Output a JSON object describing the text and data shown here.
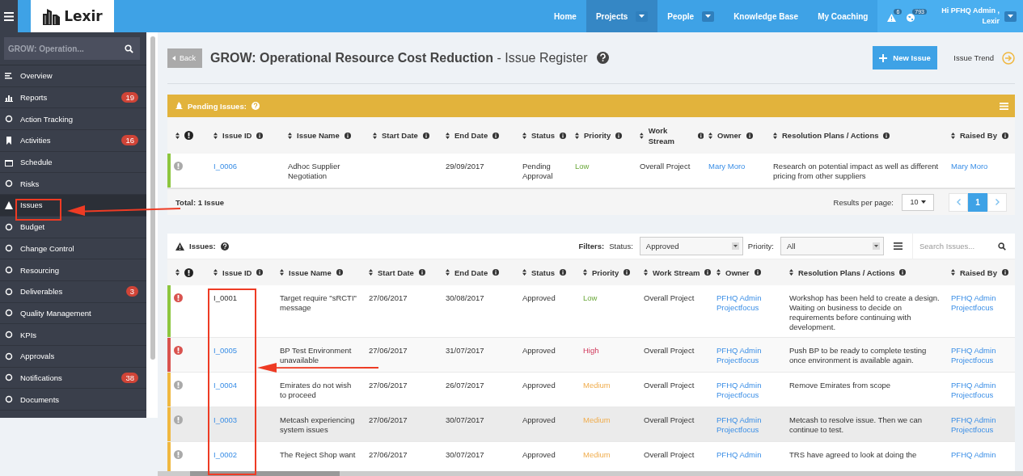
{
  "logo": "Lexir",
  "nav": [
    {
      "label": "Home",
      "selected": false,
      "dropdown": false
    },
    {
      "label": "Projects",
      "selected": true,
      "dropdown": true
    },
    {
      "label": "People",
      "selected": false,
      "dropdown": true
    },
    {
      "label": "Knowledge Base",
      "selected": false,
      "dropdown": false
    },
    {
      "label": "My Coaching",
      "selected": false,
      "dropdown": false
    }
  ],
  "alerts_badge": "6",
  "globe_badge": "793",
  "user": "Hi PFHQ Admin , Lexir",
  "sidebar": {
    "search_value": "GROW: Operation...",
    "items": [
      {
        "label": "Overview",
        "selected": false
      },
      {
        "label": "Reports",
        "selected": false,
        "badge": "19"
      },
      {
        "label": "Action Tracking",
        "selected": false
      },
      {
        "label": "Activities",
        "selected": false,
        "badge": "16"
      },
      {
        "label": "Schedule",
        "selected": false
      },
      {
        "label": "Risks",
        "selected": false
      },
      {
        "label": "Issues",
        "selected": true
      },
      {
        "label": "Budget",
        "selected": false
      },
      {
        "label": "Change Control",
        "selected": false
      },
      {
        "label": "Resourcing",
        "selected": false
      },
      {
        "label": "Deliverables",
        "selected": false,
        "badge": "3"
      },
      {
        "label": "Quality Management",
        "selected": false
      },
      {
        "label": "KPIs",
        "selected": false
      },
      {
        "label": "Approvals",
        "selected": false
      },
      {
        "label": "Notifications",
        "selected": false,
        "badge": "38"
      },
      {
        "label": "Documents",
        "selected": false
      }
    ]
  },
  "back_button": "Back",
  "title_bold": "GROW: Operational Resource Cost Reduction",
  "title_rest": "- Issue Register",
  "new_issue_button": "New Issue",
  "issue_trend": "Issue Trend",
  "pending": {
    "title": "Pending Issues:",
    "columns": [
      "Issue ID",
      "Issue Name",
      "Start Date",
      "End Date",
      "Status",
      "Priority",
      "Work Stream",
      "Owner",
      "Resolution Plans / Actions",
      "Raised By"
    ],
    "rows": [
      {
        "color": "#8cc63f",
        "alert": false,
        "id": "I_0006",
        "id_link": true,
        "name": "Adhoc Supplier Negotiation",
        "start": "",
        "end": "29/09/2017",
        "status": "Pending Approval",
        "priority": {
          "label": "Low",
          "kind": "low"
        },
        "stream": "Overall Project",
        "owner": "Mary Moro",
        "resolution": "Research on potential impact as well as different pricing from other suppliers",
        "raised_by": "Mary Moro",
        "selected": false
      }
    ],
    "total": "Total: 1 Issue",
    "results_label": "Results per page:",
    "results_value": "10",
    "page": "1"
  },
  "issues": {
    "title": "Issues:",
    "filters_label": "Filters:",
    "status_label": "Status:",
    "status_value": "Approved",
    "priority_label": "Priority:",
    "priority_value": "All",
    "search_placeholder": "Search Issues...",
    "columns": [
      "Issue ID",
      "Issue Name",
      "Start Date",
      "End Date",
      "Status",
      "Priority",
      "Work Stream",
      "Owner",
      "Resolution Plans / Actions",
      "Raised By"
    ],
    "rows": [
      {
        "color": "#8cc63f",
        "alert": true,
        "id": "I_0001",
        "id_link": false,
        "name": "Target require \"sRCTI\" message",
        "start": "27/06/2017",
        "end": "30/08/2017",
        "status": "Approved",
        "priority": {
          "label": "Low",
          "kind": "low"
        },
        "stream": "Overall Project",
        "owner": "PFHQ Admin Projectfocus",
        "resolution": "Workshop has been held to create a design. Waiting on business to decide on requirements before continuing with development.",
        "raised_by": "PFHQ Admin Projectfocus",
        "selected": false
      },
      {
        "color": "#d9534f",
        "alert": true,
        "id": "I_0005",
        "id_link": true,
        "name": "BP Test Environment unavailable",
        "start": "27/06/2017",
        "end": "31/07/2017",
        "status": "Approved",
        "priority": {
          "label": "High",
          "kind": "high"
        },
        "stream": "Overall Project",
        "owner": "PFHQ Admin Projectfocus",
        "resolution": "Push BP to be ready to complete testing once environment is available again.",
        "raised_by": "PFHQ Admin Projectfocus",
        "selected": false
      },
      {
        "color": "#f0b840",
        "alert": false,
        "id": "I_0004",
        "id_link": true,
        "name": "Emirates do not wish to proceed",
        "start": "27/06/2017",
        "end": "26/07/2017",
        "status": "Approved",
        "priority": {
          "label": "Medium",
          "kind": "medium"
        },
        "stream": "Overall Project",
        "owner": "PFHQ Admin Projectfocus",
        "resolution": "Remove Emirates from scope",
        "raised_by": "PFHQ Admin Projectfocus",
        "selected": false
      },
      {
        "color": "#f0b840",
        "alert": false,
        "id": "I_0003",
        "id_link": true,
        "name": "Metcash experiencing system issues",
        "start": "27/06/2017",
        "end": "30/07/2017",
        "status": "Approved",
        "priority": {
          "label": "Medium",
          "kind": "medium"
        },
        "stream": "Overall Project",
        "owner": "PFHQ Admin Projectfocus",
        "resolution": "Metcash to resolve issue. Then we can continue to test.",
        "raised_by": "PFHQ Admin Projectfocus",
        "selected": true
      },
      {
        "color": "#f0b840",
        "alert": false,
        "id": "I_0002",
        "id_link": true,
        "name": "The Reject Shop want",
        "start": "27/06/2017",
        "end": "30/07/2017",
        "status": "Approved",
        "priority": {
          "label": "Medium",
          "kind": "medium"
        },
        "stream": "Overall Project",
        "owner": "PFHQ Admin",
        "resolution": "TRS have agreed to look at doing the",
        "raised_by": "PFHQ Admin",
        "selected": false
      }
    ]
  }
}
